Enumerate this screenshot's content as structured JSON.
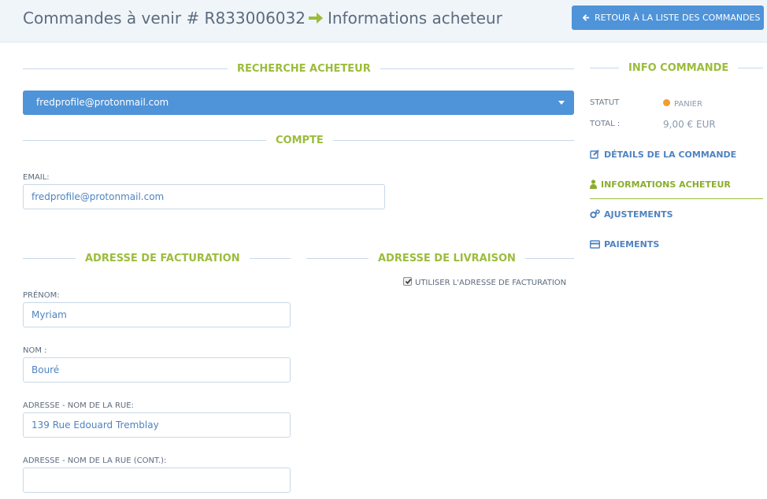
{
  "header": {
    "title_part1": "Commandes à venir # R833006032",
    "title_part2": "Informations acheteur",
    "back_button": "RETOUR À LA LISTE DES COMMANDES"
  },
  "sections": {
    "customer_search": "RECHERCHE ACHETEUR",
    "account": "COMPTE",
    "billing_address": "ADRESSE DE FACTURATION",
    "shipping_address": "ADRESSE DE LIVRAISON"
  },
  "customer_search": {
    "selected": "fredprofile@protonmail.com"
  },
  "account": {
    "email_label": "EMAIL:",
    "email_value": "fredprofile@protonmail.com"
  },
  "shipping": {
    "use_billing_label": "UTILISER L'ADRESSE DE FACTURATION",
    "use_billing_checked": true
  },
  "billing": {
    "firstname_label": "PRÉNOM:",
    "firstname_value": "Myriam",
    "lastname_label": "NOM :",
    "lastname_value": "Bouré",
    "street_label": "ADRESSE - NOM DE LA RUE:",
    "street_value": "139 Rue Edouard Tremblay",
    "street2_label": "ADRESSE - NOM DE LA RUE (CONT.):",
    "street2_value": ""
  },
  "order_info": {
    "title": "INFO COMMANDE",
    "status_label": "STATUT",
    "status_value": "PANIER",
    "total_label": "TOTAL :",
    "total_value": "9,00 € EUR"
  },
  "nav": {
    "order_details": "DÉTAILS DE LA COMMANDE",
    "customer_details": "INFORMATIONS ACHETEUR",
    "adjustments": "AJUSTEMENTS",
    "payments": "PAIEMENTS"
  },
  "colors": {
    "accent_green": "#9cbc3c",
    "primary_blue": "#4f93d8",
    "status_orange": "#f39c2f"
  }
}
